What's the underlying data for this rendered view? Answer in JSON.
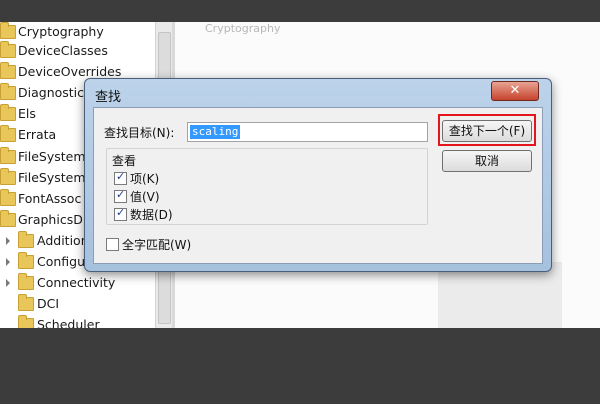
{
  "registry_tree": {
    "items": [
      {
        "label": "Cryptography"
      },
      {
        "label": "DeviceClasses"
      },
      {
        "label": "DeviceOverrides"
      },
      {
        "label": "Diagnostics"
      },
      {
        "label": "Els"
      },
      {
        "label": "Errata"
      },
      {
        "label": "FileSystem"
      },
      {
        "label": "FileSystemU"
      },
      {
        "label": "FontAssoc"
      },
      {
        "label": "GraphicsDr"
      },
      {
        "label": "Addition"
      },
      {
        "label": "Configu"
      },
      {
        "label": "Connectivity"
      },
      {
        "label": "DCI"
      },
      {
        "label": "Scheduler"
      }
    ]
  },
  "right_pane": {
    "header": "Cryptography"
  },
  "find_dialog": {
    "title": "查找",
    "close_label": "✕",
    "find_what_label": "查找目标(N):",
    "find_what_value": "scaling",
    "find_next_label": "查找下一个(F)",
    "cancel_label": "取消",
    "look_at_label": "查看",
    "options": [
      {
        "label": "项(K)",
        "checked": true
      },
      {
        "label": "值(V)",
        "checked": true
      },
      {
        "label": "数据(D)",
        "checked": true
      }
    ],
    "whole_string": {
      "label": "全字匹配(W)",
      "checked": false
    },
    "highlight_color": "#e4161b"
  }
}
